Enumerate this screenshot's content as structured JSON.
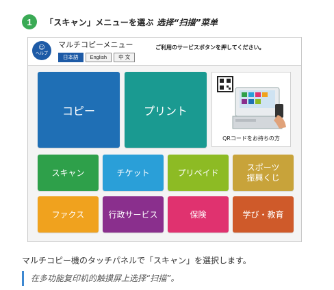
{
  "step": {
    "number": "1",
    "title_ja": "「スキャン」メニューを選ぶ",
    "title_zh": "选择“扫描”菜单"
  },
  "panel": {
    "help_label": "ヘルプ",
    "menu_title": "マルチコピーメニュー",
    "instruction": "ご利用のサービスボタンを押してください。",
    "languages": [
      {
        "label": "日本語",
        "active": true
      },
      {
        "label": "English",
        "active": false
      },
      {
        "label": "中 文",
        "active": false
      }
    ],
    "tiles": {
      "copy": {
        "label": "コピー",
        "color": "#1f6fb5"
      },
      "print": {
        "label": "プリント",
        "color": "#1a9a91"
      },
      "qr": {
        "caption": "QRコードをお持ちの方"
      },
      "scan": {
        "label": "スキャン",
        "color": "#2ea04a"
      },
      "ticket": {
        "label": "チケット",
        "color": "#2a9fd8"
      },
      "prepaid": {
        "label": "プリペイド",
        "color": "#8dbb24"
      },
      "sports_line1": "スポーツ",
      "sports_line2": "振興くじ",
      "sports_color": "#c8a33a",
      "fax": {
        "label": "ファクス",
        "color": "#f0a21e"
      },
      "gov": {
        "label": "行政サービス",
        "color": "#8a2f8d"
      },
      "insurance": {
        "label": "保険",
        "color": "#e0326f"
      },
      "edu": {
        "label": "学び・教育",
        "color": "#cf5a2a"
      }
    }
  },
  "description_ja": "マルチコピー機のタッチパネルで「スキャン」を選択します。",
  "note_zh": "在多功能复印机的触摸屏上选择“扫描”。"
}
